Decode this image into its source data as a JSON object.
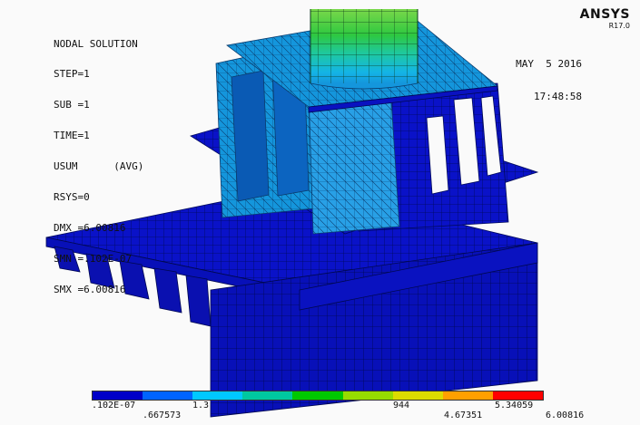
{
  "plot": {
    "title": "NODAL SOLUTION",
    "lines": [
      "STEP=1",
      "SUB =1",
      "TIME=1",
      "USUM      (AVG)",
      "RSYS=0",
      "DMX =6.00816",
      "SMN =.102E-07",
      "SMX =6.00816"
    ]
  },
  "brand": {
    "name": "ANSYS",
    "version": "R17.0"
  },
  "datetime": {
    "date": "MAY  5 2016",
    "time": "17:48:58"
  },
  "legend": {
    "colors": [
      "#0000c8",
      "#0064ff",
      "#00c8ff",
      "#00c8a0",
      "#00c800",
      "#96dc00",
      "#dcdc00",
      "#ffa000",
      "#ff0000"
    ],
    "upper_labels": [
      ".102E-07",
      "1.3",
      "",
      "",
      "",
      "",
      "",
      "",
      "5.34059"
    ],
    "lower_labels": [
      ".667573",
      "",
      "",
      "",
      "944",
      "",
      "4.67351",
      "",
      "6.00816"
    ]
  }
}
